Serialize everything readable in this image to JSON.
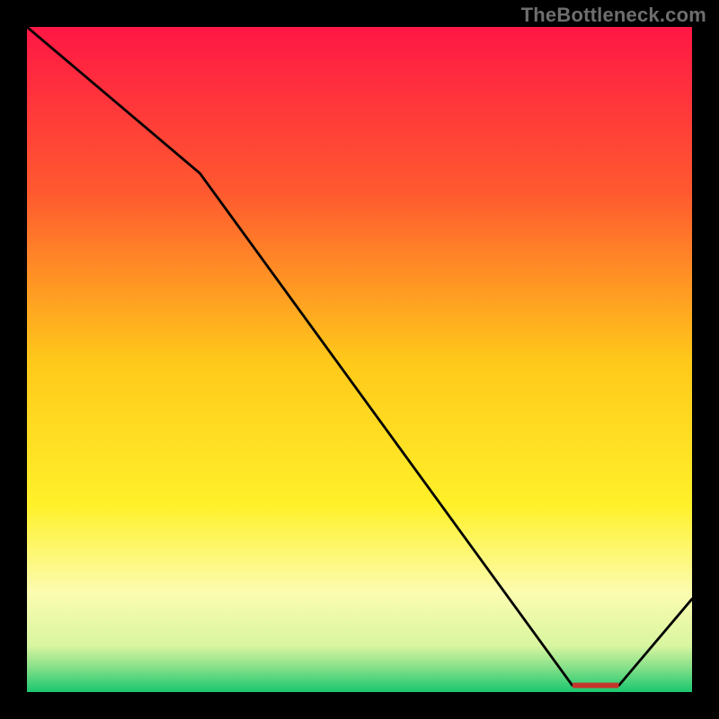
{
  "watermark": "TheBottleneck.com",
  "chart_data": {
    "type": "line",
    "title": "",
    "xlabel": "",
    "ylabel": "",
    "xlim": [
      0,
      100
    ],
    "ylim": [
      0,
      100
    ],
    "x": [
      0,
      26,
      82,
      89,
      100
    ],
    "values": [
      100,
      78,
      1,
      1,
      14
    ],
    "gradient_stops": [
      {
        "pct": 0,
        "color": "#ff1745"
      },
      {
        "pct": 25,
        "color": "#ff5a2f"
      },
      {
        "pct": 50,
        "color": "#ffc81a"
      },
      {
        "pct": 72,
        "color": "#fff12a"
      },
      {
        "pct": 85,
        "color": "#fcfcb0"
      },
      {
        "pct": 93,
        "color": "#d9f5a0"
      },
      {
        "pct": 96,
        "color": "#8ee28b"
      },
      {
        "pct": 100,
        "color": "#19c76f"
      }
    ],
    "marker": {
      "x_start": 82,
      "x_end": 89,
      "y": 1,
      "color": "#c3352b",
      "label": ""
    }
  }
}
